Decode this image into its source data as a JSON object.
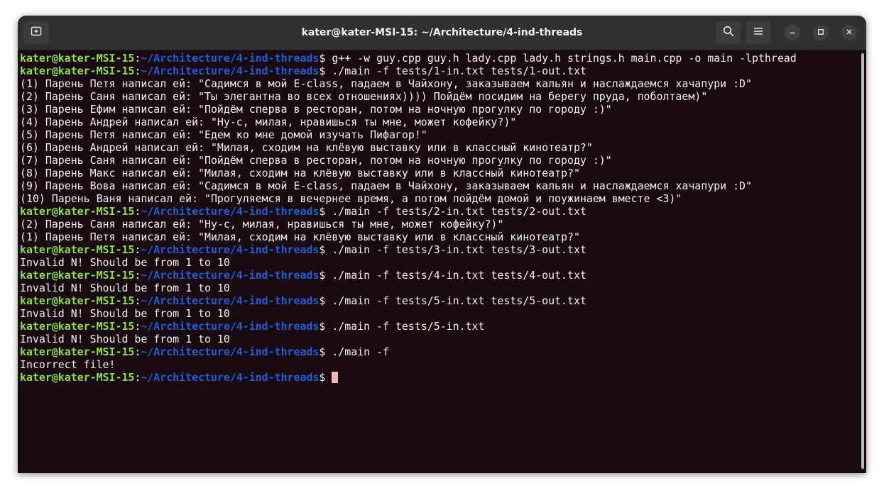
{
  "window": {
    "title": "kater@kater-MSI-15: ~/Architecture/4-ind-threads"
  },
  "prompt": {
    "user_host": "kater@kater-MSI-15",
    "separator": ":",
    "path": "~/Architecture/4-ind-threads",
    "symbol": "$ "
  },
  "lines": [
    {
      "type": "cmd",
      "text": "g++ -w guy.cpp guy.h lady.cpp lady.h strings.h main.cpp -o main -lpthread"
    },
    {
      "type": "cmd",
      "text": "./main -f tests/1-in.txt tests/1-out.txt"
    },
    {
      "type": "out",
      "text": "(1) Парень Петя написал ей: \"Садимся в мой E-class, падаем в Чайхону, заказываем кальян и наслаждаемся хачапури :D\""
    },
    {
      "type": "out",
      "text": "(2) Парень Саня написал ей: \"Ты элегантна во всех отношениях)))) Пойдём посидим на берегу пруда, поболтаем)\""
    },
    {
      "type": "out",
      "text": "(3) Парень Ефим написал ей: \"Пойдём сперва в ресторан, потом на ночную прогулку по городу :)\""
    },
    {
      "type": "out",
      "text": "(4) Парень Андрей написал ей: \"Ну-с, милая, нравишься ты мне, может кофейку?)\""
    },
    {
      "type": "out",
      "text": "(5) Парень Петя написал ей: \"Едем ко мне домой изучать Пифагор!\""
    },
    {
      "type": "out",
      "text": "(6) Парень Андрей написал ей: \"Милая, сходим на клёвую выставку или в классный кинотеатр?\""
    },
    {
      "type": "out",
      "text": "(7) Парень Саня написал ей: \"Пойдём сперва в ресторан, потом на ночную прогулку по городу :)\""
    },
    {
      "type": "out",
      "text": "(8) Парень Макс написал ей: \"Милая, сходим на клёвую выставку или в классный кинотеатр?\""
    },
    {
      "type": "out",
      "text": "(9) Парень Вова написал ей: \"Садимся в мой E-class, падаем в Чайхону, заказываем кальян и наслаждаемся хачапури :D\""
    },
    {
      "type": "out",
      "text": "(10) Парень Ваня написал ей: \"Прогуляемся в вечернее время, а потом пойдём домой и поужинаем вместе <3)\""
    },
    {
      "type": "cmd",
      "text": "./main -f tests/2-in.txt tests/2-out.txt"
    },
    {
      "type": "out",
      "text": "(2) Парень Саня написал ей: \"Ну-с, милая, нравишься ты мне, может кофейку?)\""
    },
    {
      "type": "out",
      "text": "(1) Парень Петя написал ей: \"Милая, сходим на клёвую выставку или в классный кинотеатр?\""
    },
    {
      "type": "cmd",
      "text": "./main -f tests/3-in.txt tests/3-out.txt"
    },
    {
      "type": "out",
      "text": "Invalid N! Should be from 1 to 10"
    },
    {
      "type": "cmd",
      "text": "./main -f tests/4-in.txt tests/4-out.txt"
    },
    {
      "type": "out",
      "text": "Invalid N! Should be from 1 to 10"
    },
    {
      "type": "cmd",
      "text": "./main -f tests/5-in.txt tests/5-out.txt"
    },
    {
      "type": "out",
      "text": "Invalid N! Should be from 1 to 10"
    },
    {
      "type": "cmd",
      "text": "./main -f tests/5-in.txt"
    },
    {
      "type": "out",
      "text": "Invalid N! Should be from 1 to 10"
    },
    {
      "type": "cmd",
      "text": "./main -f"
    },
    {
      "type": "out",
      "text": "Incorrect file!"
    },
    {
      "type": "cmd",
      "text": "",
      "cursor": true
    }
  ],
  "icons": {
    "new_tab": "new-tab-icon",
    "search": "search-icon",
    "menu": "hamburger-menu-icon",
    "minimize": "minimize-icon",
    "maximize": "maximize-icon",
    "close": "close-icon"
  },
  "colors": {
    "terminal_bg": "#180a10",
    "titlebar_bg": "#303030",
    "prompt_user": "#8ae234",
    "prompt_path": "#1c5fd8",
    "text": "#f2f2f2",
    "cursor": "#f6b4b4"
  }
}
